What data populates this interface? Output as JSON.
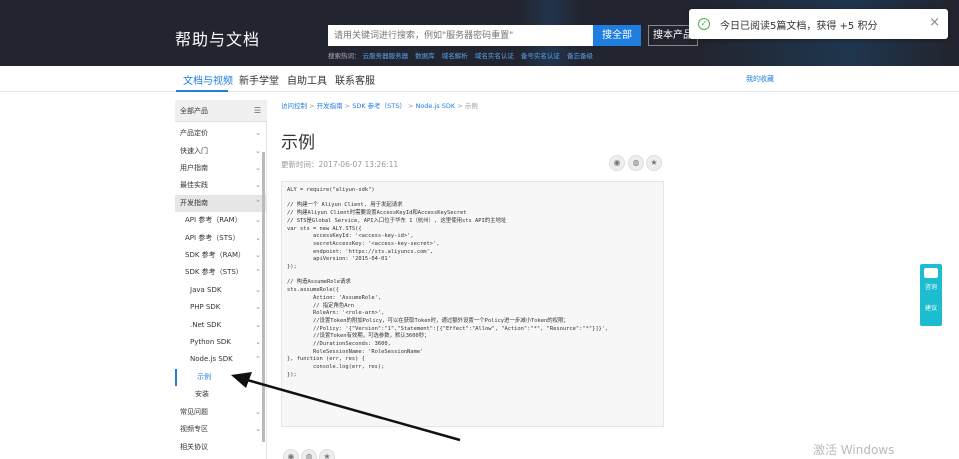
{
  "header": {
    "brand": "帮助与文档",
    "search_placeholder": "请用关键词进行搜索，例如\"服务器密码重置\"",
    "search_all_btn": "搜全部",
    "search_product_btn": "搜本产品",
    "hot_label": "搜索热词：",
    "hot_links": [
      "云服务器服务器",
      "数据库",
      "域名解析",
      "域名实名认证",
      "备号实名认证",
      "备忘备级"
    ]
  },
  "toast": {
    "message": "今日已阅读5篇文档，获得 +5 积分",
    "close": "×"
  },
  "tabs": {
    "items": [
      "文档与视频",
      "新手学堂",
      "自助工具",
      "联系客服"
    ],
    "my_fav": "我的收藏"
  },
  "sidebar": {
    "header": "全部产品",
    "items": [
      {
        "label": "产品定价",
        "indent": 0
      },
      {
        "label": "快速入门",
        "indent": 0
      },
      {
        "label": "用户指南",
        "indent": 0
      },
      {
        "label": "最佳实践",
        "indent": 0
      },
      {
        "label": "开发指南",
        "indent": 0
      },
      {
        "label": "API 参考（RAM）",
        "indent": 1
      },
      {
        "label": "API 参考（STS）",
        "indent": 1
      },
      {
        "label": "SDK 参考（RAM）",
        "indent": 1
      },
      {
        "label": "SDK 参考（STS）",
        "indent": 1
      },
      {
        "label": "Java SDK",
        "indent": 2
      },
      {
        "label": "PHP SDK",
        "indent": 2
      },
      {
        "label": ".Net SDK",
        "indent": 2
      },
      {
        "label": "Python SDK",
        "indent": 2
      },
      {
        "label": "Node.js SDK",
        "indent": 2
      },
      {
        "label": "示例",
        "indent": 3
      },
      {
        "label": "安装",
        "indent": 3
      },
      {
        "label": "常见问题",
        "indent": 0
      },
      {
        "label": "视频专区",
        "indent": 0
      },
      {
        "label": "相关协议",
        "indent": 0
      }
    ]
  },
  "content": {
    "breadcrumb": [
      "访问控制",
      "开发指南",
      "SDK 参考（STS）",
      "Node.js SDK",
      "示例"
    ],
    "title": "示例",
    "updated": "更新时间：2017-06-07 13:26:11",
    "code": "ALY = require(\"aliyun-sdk\")\n\n// 构建一个 Aliyun Client, 用于发起请求\n// 构建Aliyun Client时需要设置AccessKeyId和AccessKeySecret\n// STS是Global Service, API入口位于华东 1（杭州）, 这里使用sts API的主地址\nvar sts = new ALY.STS({\n        accessKeyId: '<access-key-id>',\n        secretAccessKey: '<access-key-secret>',\n        endpoint: 'https://sts.aliyuncs.com',\n        apiVersion: '2015-04-01'\n});\n\n// 构造AssumeRole请求\nsts.assumeRole({\n        Action: 'AssumeRole',\n        // 指定角色Arn\n        RoleArn: '<role-arn>',\n        //设置Token的附加Policy，可以在获取Token时，通过额外设置一个Policy进一步减小Token的权限；\n        //Policy: '{\"Version\":\"1\",\"Statement\":[{\"Effect\":\"Allow\", \"Action\":\"*\", \"Resource\":\"*\"}]}',\n        //设置Token有效期，可选参数，默认3600秒；\n        //DurationSeconds: 3600,\n        RoleSessionName: 'RoleSessionName'\n}, function (err, res) {\n        console.log(err, res);\n});"
  },
  "float": {
    "line1": "咨询",
    "line2": "建议"
  },
  "watermark": "激活 Windows"
}
